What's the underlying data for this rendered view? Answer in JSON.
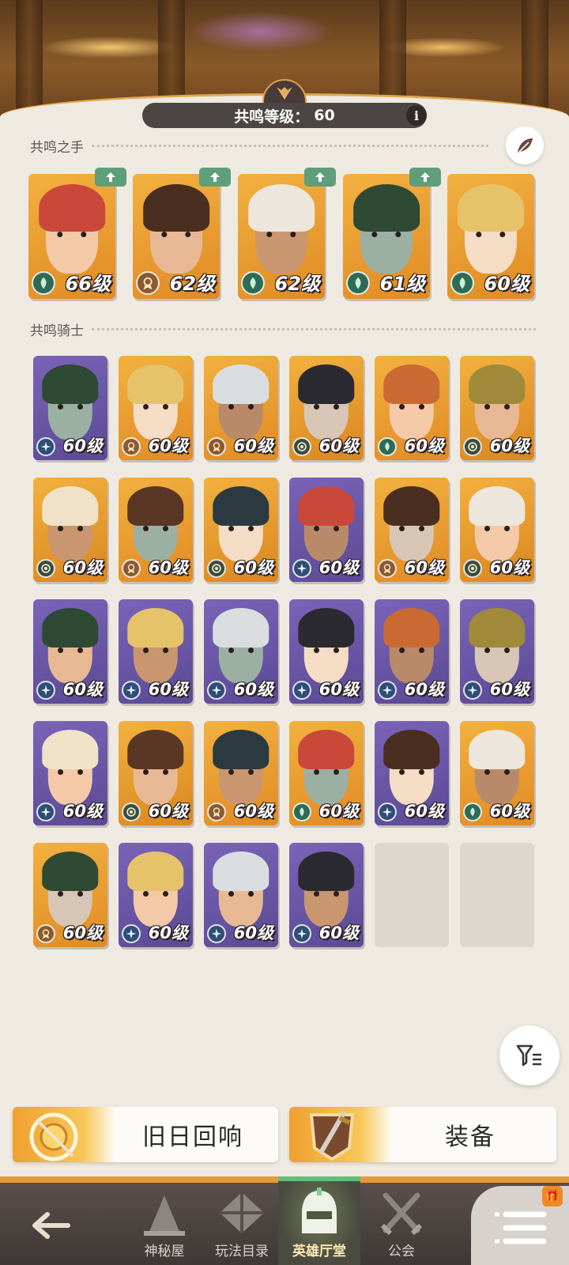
{
  "header": {
    "resonance_label": "共鸣等级：",
    "resonance_level": "60",
    "info_label": "i"
  },
  "sections": {
    "hand_title": "共鸣之手",
    "knight_title": "共鸣骑士"
  },
  "hand_cards": [
    {
      "level": "66级",
      "faction": "forest",
      "upgradable": true
    },
    {
      "level": "62级",
      "faction": "tower",
      "upgradable": true
    },
    {
      "level": "62级",
      "faction": "forest",
      "upgradable": true
    },
    {
      "level": "61级",
      "faction": "forest",
      "upgradable": true
    },
    {
      "level": "60级",
      "faction": "forest",
      "upgradable": false
    }
  ],
  "knight_cards": [
    {
      "level": "60级",
      "faction": "light"
    },
    {
      "level": "60级",
      "faction": "tower"
    },
    {
      "level": "60级",
      "faction": "tower"
    },
    {
      "level": "60级",
      "faction": "grave"
    },
    {
      "level": "60级",
      "faction": "forest"
    },
    {
      "level": "60级",
      "faction": "grave"
    },
    {
      "level": "60级",
      "faction": "grave"
    },
    {
      "level": "60级",
      "faction": "tower"
    },
    {
      "level": "60级",
      "faction": "grave"
    },
    {
      "level": "60级",
      "faction": "light"
    },
    {
      "level": "60级",
      "faction": "tower"
    },
    {
      "level": "60级",
      "faction": "grave"
    },
    {
      "level": "60级",
      "faction": "light"
    },
    {
      "level": "60级",
      "faction": "light"
    },
    {
      "level": "60级",
      "faction": "light"
    },
    {
      "level": "60级",
      "faction": "light"
    },
    {
      "level": "60级",
      "faction": "light"
    },
    {
      "level": "60级",
      "faction": "light"
    },
    {
      "level": "60级",
      "faction": "light"
    },
    {
      "level": "60级",
      "faction": "grave"
    },
    {
      "level": "60级",
      "faction": "tower"
    },
    {
      "level": "60级",
      "faction": "forest"
    },
    {
      "level": "60级",
      "faction": "light"
    },
    {
      "level": "60级",
      "faction": "forest"
    },
    {
      "level": "60级",
      "faction": "tower"
    },
    {
      "level": "60级",
      "faction": "light"
    },
    {
      "level": "60级",
      "faction": "light"
    },
    {
      "level": "60级",
      "faction": "light"
    }
  ],
  "empty_slots": 2,
  "buttons": {
    "echo_label": "旧日回响",
    "equipment_label": "装备"
  },
  "nav": {
    "items": [
      {
        "label": "神秘屋"
      },
      {
        "label": "玩法目录"
      },
      {
        "label": "英雄厅堂"
      },
      {
        "label": "公会"
      }
    ],
    "active_index": 2
  },
  "colors": {
    "accent": "#e59a3a",
    "light_faction": "#2e4e78",
    "forest_faction": "#2f6a55",
    "grave_faction": "#3e4a3a",
    "tower_faction": "#8a5a30"
  }
}
